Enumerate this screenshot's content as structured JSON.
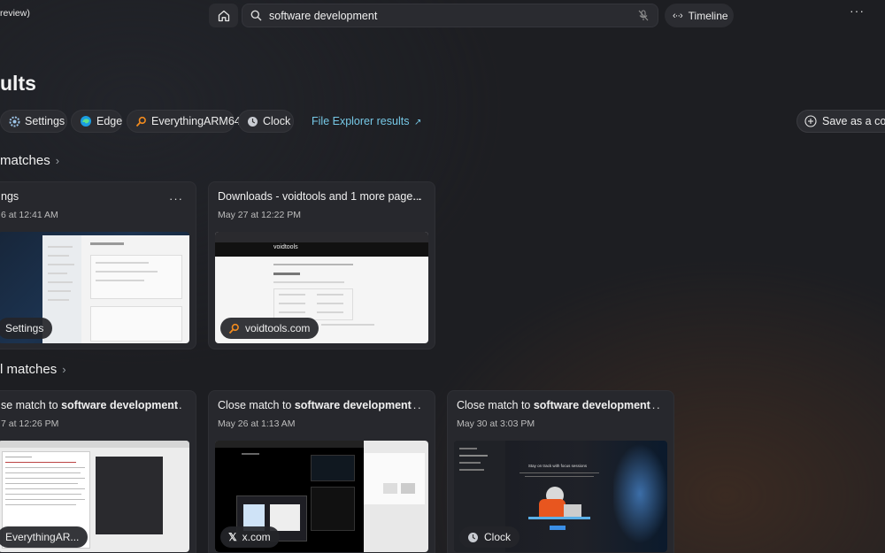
{
  "app": {
    "title_fragment": "review)"
  },
  "search": {
    "query": "software development"
  },
  "timeline": {
    "label": "Timeline"
  },
  "page": {
    "title": "ults"
  },
  "filters": [
    {
      "label": "Settings",
      "icon": "gear-icon"
    },
    {
      "label": "Edge",
      "icon": "edge-icon"
    },
    {
      "label": "EverythingARM64",
      "icon": "everything-icon"
    },
    {
      "label": "Clock",
      "icon": "clock-icon"
    }
  ],
  "file_explorer": {
    "label": "File Explorer results"
  },
  "save_collection": {
    "label": "Save as a colle"
  },
  "section1": {
    "title": "matches"
  },
  "section2": {
    "title": "l matches"
  },
  "cards_top": [
    {
      "title": "ngs",
      "date": "6 at 12:41 AM",
      "badge": "Settings"
    },
    {
      "title": "Downloads - voidtools and 1 more page...",
      "date": "May 27 at 12:22 PM",
      "badge": "voidtools.com"
    }
  ],
  "cards_bottom": [
    {
      "prefix": "se match to ",
      "bold": "software development",
      "date": "7 at 12:26 PM",
      "badge": "EverythingAR..."
    },
    {
      "prefix": "Close match to ",
      "bold": "software development",
      "date": "May 26 at 1:13 AM",
      "badge": "x.com"
    },
    {
      "prefix": "Close match to ",
      "bold": "software development",
      "date": "May 30 at 3:03 PM",
      "badge": "Clock"
    }
  ],
  "thumbs": {
    "voidtools_heading": "voidtools",
    "clock_focus_text": "Stay on track with focus sessions"
  },
  "colors": {
    "accent_link": "#76c8e6",
    "background": "#1d1e22",
    "card": "#27282d"
  }
}
